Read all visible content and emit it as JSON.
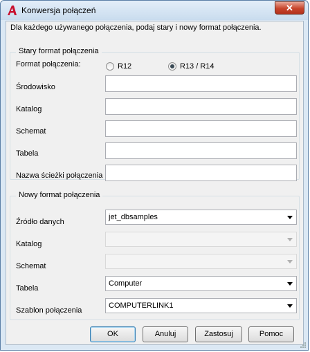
{
  "window": {
    "title": "Konwersja połączeń",
    "close_label": "✕"
  },
  "description": "Dla każdego używanego połączenia, podaj stary i nowy format połączenia.",
  "old_format": {
    "group_title": "Stary format połączenia",
    "format_label": "Format połączenia:",
    "radio_r12": "R12",
    "radio_r13": "R13 / R14",
    "selected": "R13 / R14",
    "fields": [
      {
        "label": "Środowisko",
        "value": ""
      },
      {
        "label": "Katalog",
        "value": ""
      },
      {
        "label": "Schemat",
        "value": ""
      },
      {
        "label": "Tabela",
        "value": ""
      },
      {
        "label": "Nazwa ścieżki połączenia",
        "value": ""
      }
    ]
  },
  "new_format": {
    "group_title": "Nowy format połączenia",
    "fields": [
      {
        "label": "Źródło danych",
        "value": "jet_dbsamples",
        "enabled": true
      },
      {
        "label": "Katalog",
        "value": "",
        "enabled": false
      },
      {
        "label": "Schemat",
        "value": "",
        "enabled": false
      },
      {
        "label": "Tabela",
        "value": "Computer",
        "enabled": true
      },
      {
        "label": "Szablon połączenia",
        "value": "COMPUTERLINK1",
        "enabled": true
      }
    ]
  },
  "buttons": {
    "ok": "OK",
    "cancel": "Anuluj",
    "apply": "Zastosuj",
    "help": "Pomoc"
  },
  "colors": {
    "title_icon": "#c8102e"
  }
}
